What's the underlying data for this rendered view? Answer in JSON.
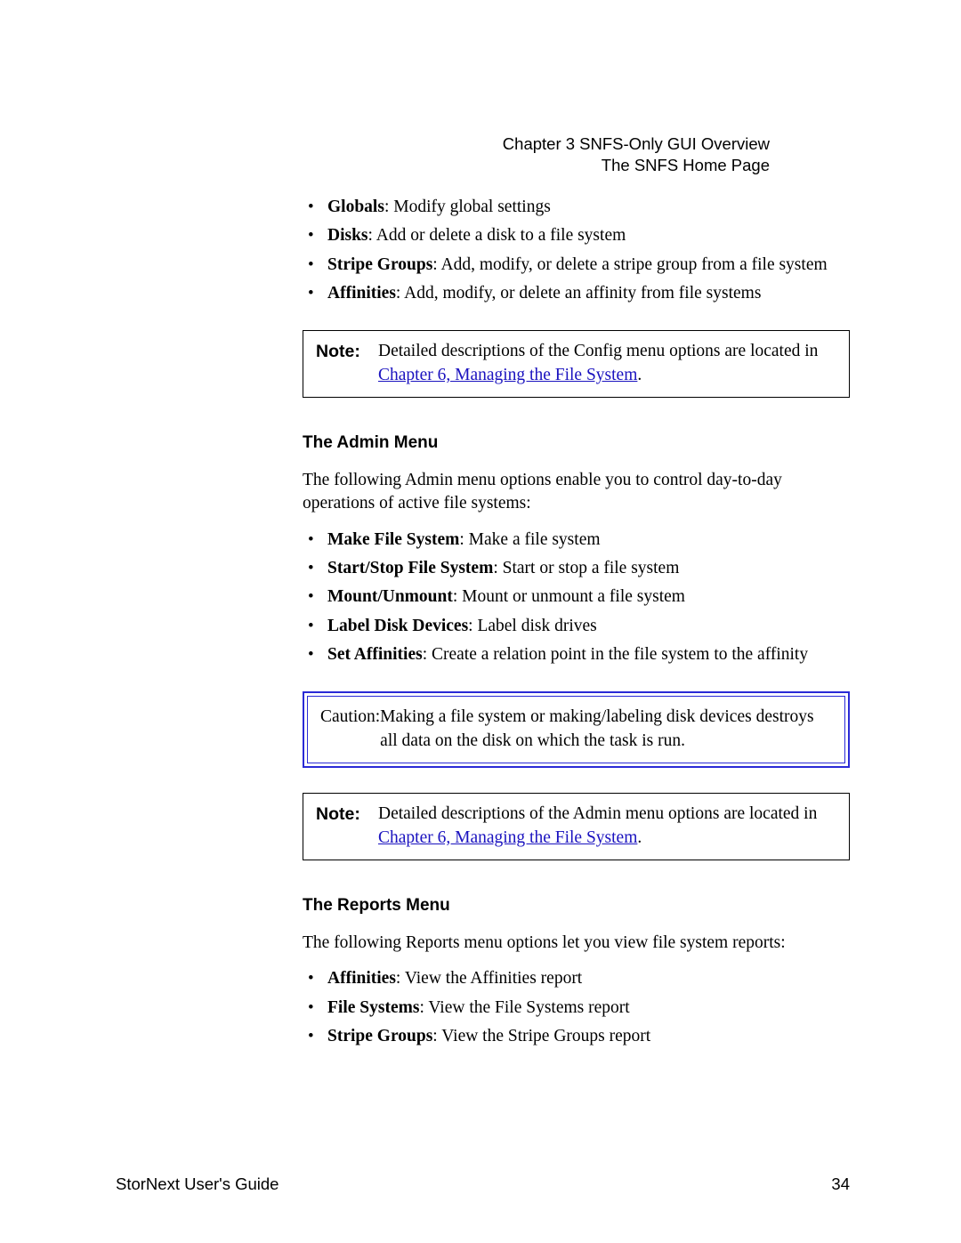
{
  "header": {
    "chapter_line": "Chapter 3  SNFS-Only GUI Overview",
    "section_line": "The SNFS Home Page"
  },
  "config_list": [
    {
      "term": "Globals",
      "desc": ": Modify global settings"
    },
    {
      "term": "Disks",
      "desc": ": Add or delete a disk to a file system"
    },
    {
      "term": "Stripe Groups",
      "desc": ": Add, modify, or delete a stripe group from a file system"
    },
    {
      "term": "Affinities",
      "desc": ": Add, modify, or delete an affinity from file systems"
    }
  ],
  "note1": {
    "label": "Note:",
    "text_before": "Detailed descriptions of the Config menu options are located in ",
    "link": "Chapter 6, Managing the File System",
    "text_after": "."
  },
  "admin": {
    "heading": "The Admin Menu",
    "intro": "The following Admin menu options enable you to control day-to-day operations of active file systems:",
    "list": [
      {
        "term": "Make File System",
        "desc": ": Make a file system"
      },
      {
        "term": "Start/Stop File System",
        "desc": ": Start or stop a file system"
      },
      {
        "term": "Mount/Unmount",
        "desc": ": Mount or unmount a file system"
      },
      {
        "term": "Label Disk Devices",
        "desc": ": Label disk drives"
      },
      {
        "term": "Set Affinities",
        "desc": ": Create a relation point in the file system to the affinity"
      }
    ]
  },
  "caution": {
    "label": "Caution:",
    "text": "Making a file system or making/labeling disk devices destroys all data on the disk on which the task is run."
  },
  "note2": {
    "label": "Note:",
    "text_before": "Detailed descriptions of the Admin menu options are located in ",
    "link": "Chapter 6, Managing the File System",
    "text_after": "."
  },
  "reports": {
    "heading": "The Reports Menu",
    "intro": "The following Reports menu options let you view file system reports:",
    "list": [
      {
        "term": "Affinities",
        "desc": ": View the Affinities report"
      },
      {
        "term": "File Systems",
        "desc": ": View the File Systems report"
      },
      {
        "term": "Stripe Groups",
        "desc": ": View the Stripe Groups report"
      }
    ]
  },
  "footer": {
    "left": "StorNext User's Guide",
    "right": "34"
  }
}
